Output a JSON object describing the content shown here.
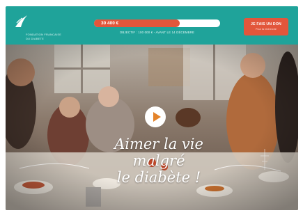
{
  "header": {
    "logo_lines": [
      "FONDATION FRANCAISE",
      "DU DIABETE"
    ],
    "fundraising": {
      "amount": "30 400 €",
      "progress": 0.68,
      "objective_text": "OBJECTIF : 100 000 € - AVANT LE 14 DÉCEMBRE"
    },
    "cta": {
      "label": "JE FAIS UN DON",
      "sublabel": "Pour la recherche"
    }
  },
  "hero": {
    "slogan": [
      "Aimer la vie",
      "malgré",
      "le diabète !"
    ],
    "play_icon": "play-icon"
  },
  "colors": {
    "teal": "#1fa39a",
    "accent": "#e2563b",
    "play": "#e4832a"
  }
}
